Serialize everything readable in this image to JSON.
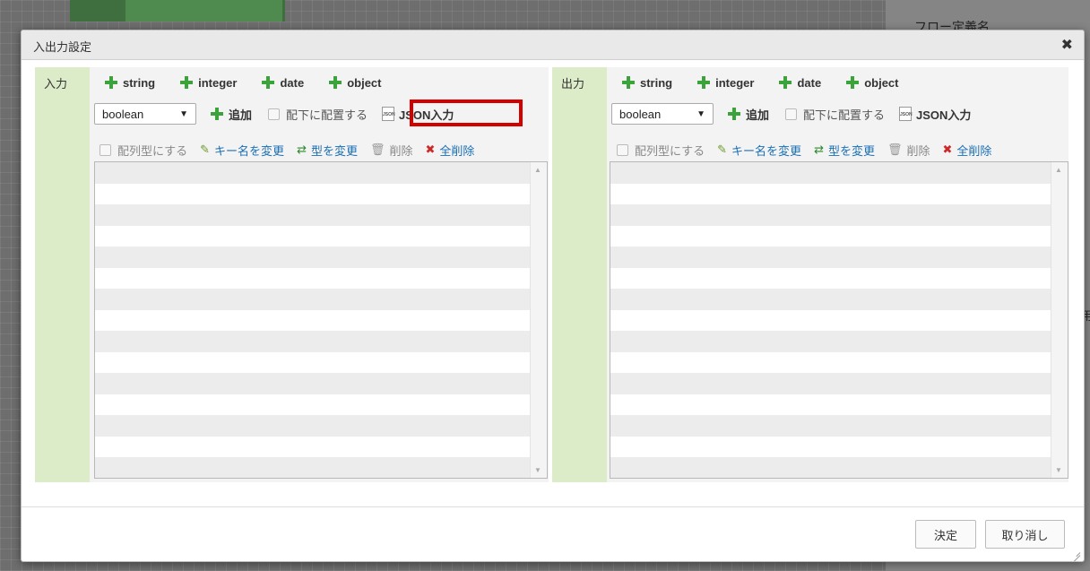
{
  "background": {
    "right_title": "フロー定義名",
    "right_char": "用"
  },
  "dialog": {
    "title": "入出力設定",
    "close_icon": "close-icon"
  },
  "input_panel": {
    "label": "入力",
    "type_buttons": [
      "string",
      "integer",
      "date",
      "object"
    ],
    "select_value": "boolean",
    "add_label": "追加",
    "place_under_label": "配下に配置する",
    "json_label": "JSON入力",
    "array_label": "配列型にする",
    "rename_label": "キー名を変更",
    "change_type_label": "型を変更",
    "delete_label": "削除",
    "delete_all_label": "全削除"
  },
  "output_panel": {
    "label": "出力",
    "type_buttons": [
      "string",
      "integer",
      "date",
      "object"
    ],
    "select_value": "boolean",
    "add_label": "追加",
    "place_under_label": "配下に配置する",
    "json_label": "JSON入力",
    "array_label": "配列型にする",
    "rename_label": "キー名を変更",
    "change_type_label": "型を変更",
    "delete_label": "削除",
    "delete_all_label": "全削除"
  },
  "footer": {
    "ok_label": "決定",
    "cancel_label": "取り消し"
  },
  "highlight_color": "#d40000"
}
